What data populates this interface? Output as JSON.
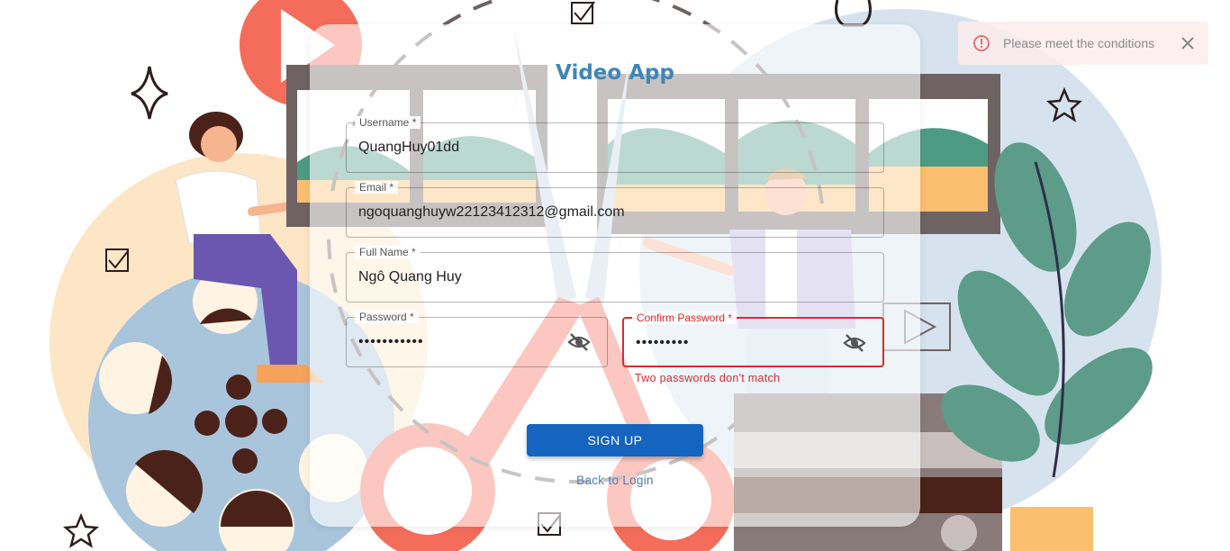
{
  "app": {
    "title": "Video App"
  },
  "form": {
    "username": {
      "label": "Username *",
      "value": "QuangHuy01dd"
    },
    "email": {
      "label": "Email *",
      "value": "ngoquanghuyw22123412312@gmail.com"
    },
    "fullname": {
      "label": "Full Name *",
      "value": "Ngô Quang Huy"
    },
    "password": {
      "label": "Password *",
      "value": "•••••••••••"
    },
    "confirm_password": {
      "label": "Confirm Password *",
      "value": "•••••••••",
      "error": "Two passwords don't match"
    },
    "signup_label": "SIGN UP",
    "back_label": "Back to Login"
  },
  "toast": {
    "message": "Please meet the conditions"
  },
  "colors": {
    "accent": "#1565c0",
    "title": "#3f86b8",
    "error": "#d32f2f"
  },
  "icons": [
    "visibility-off-icon",
    "warning-circle-icon",
    "close-icon"
  ]
}
